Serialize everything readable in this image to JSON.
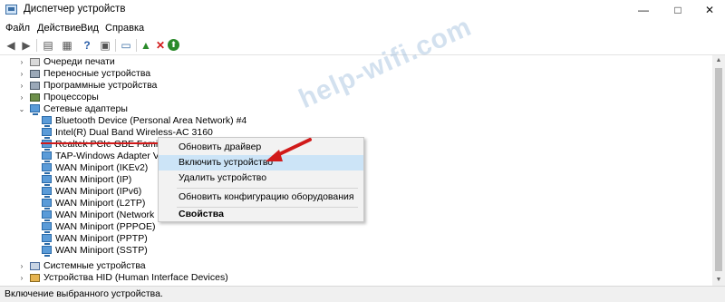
{
  "window": {
    "title": "Диспетчер устройств",
    "minimize": "—",
    "maximize": "□",
    "close": "✕"
  },
  "menu": [
    "Файл",
    "Действие",
    "Вид",
    "Справка"
  ],
  "toolbar_icons": [
    "back-icon",
    "forward-icon",
    "properties-icon",
    "list-icon",
    "help-icon",
    "device-icon",
    "monitor-icon",
    "update-driver-icon",
    "delete-icon",
    "enable-icon"
  ],
  "tree": {
    "categories_top": [
      {
        "label": "Очереди печати",
        "icon": "printer-icon",
        "expanded": false
      },
      {
        "label": "Переносные устройства",
        "icon": "portable-device-icon",
        "expanded": false
      },
      {
        "label": "Программные устройства",
        "icon": "software-device-icon",
        "expanded": false
      },
      {
        "label": "Процессоры",
        "icon": "cpu-icon",
        "expanded": false
      },
      {
        "label": "Сетевые адаптеры",
        "icon": "network-adapter-icon",
        "expanded": true
      }
    ],
    "adapters": [
      "Bluetooth Device (Personal Area Network) #4",
      "Intel(R) Dual Band Wireless-AC 3160",
      "Realtek PCIe GBE Family Co",
      "TAP-Windows Adapter V9",
      "WAN Miniport (IKEv2)",
      "WAN Miniport (IP)",
      "WAN Miniport (IPv6)",
      "WAN Miniport (L2TP)",
      "WAN Miniport (Network Mo",
      "WAN Miniport (PPPOE)",
      "WAN Miniport (PPTP)",
      "WAN Miniport (SSTP)"
    ],
    "categories_bottom": [
      {
        "label": "Системные устройства",
        "icon": "system-device-icon",
        "expanded": false
      },
      {
        "label": "Устройства HID (Human Interface Devices)",
        "icon": "hid-icon",
        "expanded": false
      }
    ]
  },
  "context_menu": {
    "update_driver": "Обновить драйвер",
    "enable_device": "Включить устройство",
    "remove_device": "Удалить устройство",
    "scan_hardware": "Обновить конфигурацию оборудования",
    "properties": "Свойства"
  },
  "watermark": "help-wifi.com",
  "status": "Включение выбранного устройства.",
  "colors": {
    "highlight": "#cce4f7",
    "annotation_red": "#d11a1a"
  }
}
